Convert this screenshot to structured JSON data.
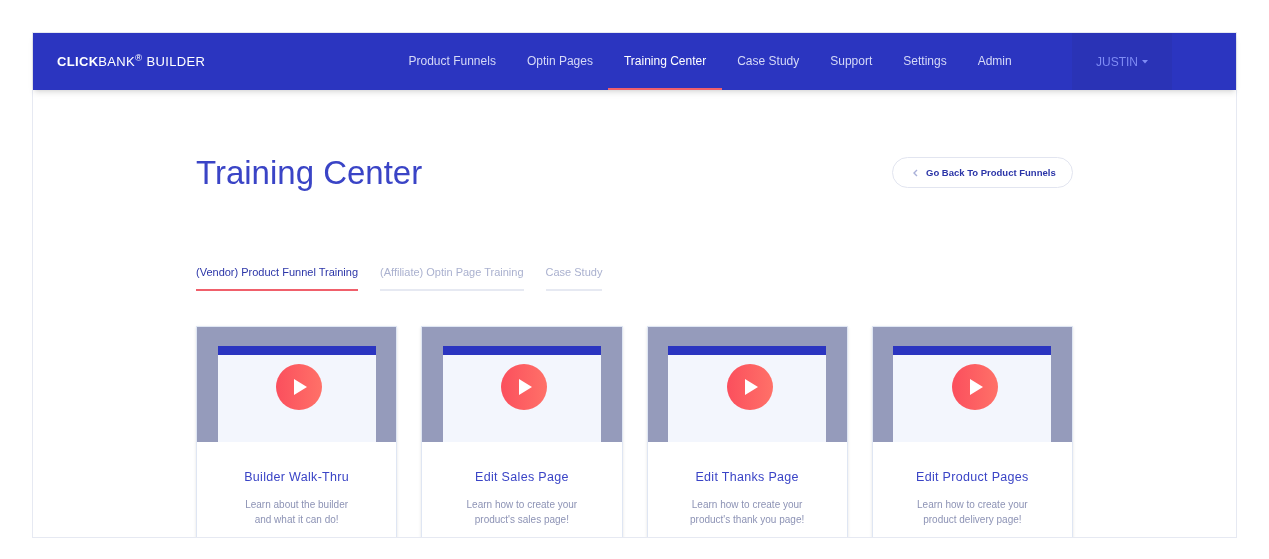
{
  "brand": "**CLICK**BANK$^{®}$ BUILDER",
  "nav": [
    {
      "label": "Product Funnels",
      "selected": false
    },
    {
      "label": "Optin Pages",
      "selected": false
    },
    {
      "label": "Training Center",
      "selected": true
    },
    {
      "label": "Case Study",
      "selected": false
    },
    {
      "label": "Support",
      "selected": false
    },
    {
      "label": "Settings",
      "selected": false
    },
    {
      "label": "Admin",
      "selected": false
    }
  ],
  "user_menu": "JUSTIN",
  "page_title": "Training Center",
  "back_button": "Go Back To Product Funnels",
  "tabs": [
    {
      "label": "(Vendor) Product Funnel Training",
      "selected": true
    },
    {
      "label": "(Affiliate) Optin Page Training",
      "selected": false
    },
    {
      "label": "Case Study",
      "selected": false
    }
  ],
  "videos": [
    {
      "title": "Builder Walk-Thru",
      "description": "Learn about the builder and what it can do!"
    },
    {
      "title": "Edit Sales Page",
      "description": "Learn how to create your product's sales page!"
    },
    {
      "title": "Edit Thanks Page",
      "description": "Learn how to create your product's thank you page!"
    },
    {
      "title": "Edit Product Pages",
      "description": "Learn how to create your product delivery page!"
    }
  ]
}
